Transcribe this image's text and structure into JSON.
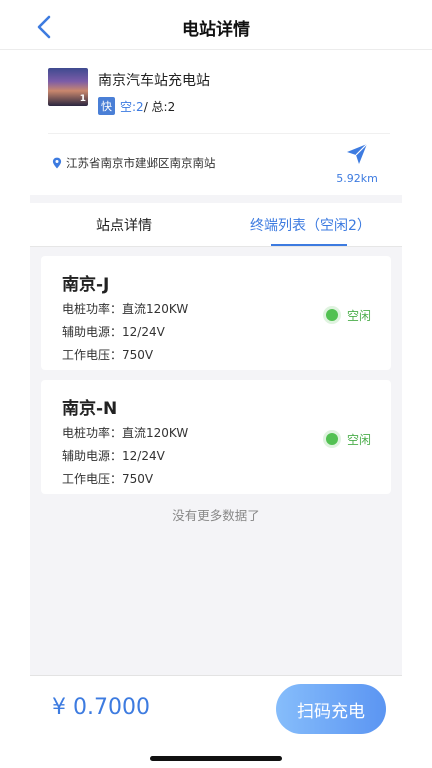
{
  "header": {
    "title": "电站详情",
    "back_icon": "chevron-left-icon"
  },
  "station": {
    "name": "南京汽车站充电站",
    "thumbnail_badge": "1",
    "fast_label": "快",
    "free_label": "空:2",
    "total_label": " / 总:2",
    "address": "江苏省南京市建邺区南京南站",
    "distance": "5.92km"
  },
  "tabs": {
    "info_label": "站点详情",
    "terminals_label": "终端列表（空闲2）",
    "active": "terminals"
  },
  "terminals": [
    {
      "name": "南京-J",
      "power": "电桩功率：直流120KW",
      "aux": "辅助电源：12/24V",
      "voltage": "工作电压：750V",
      "status": "空闲"
    },
    {
      "name": "南京-N",
      "power": "电桩功率：直流120KW",
      "aux": "辅助电源：12/24V",
      "voltage": "工作电压：750V",
      "status": "空闲"
    }
  ],
  "list": {
    "no_more": "没有更多数据了"
  },
  "footer": {
    "price": "¥ 0.7000",
    "scan_button": "扫码充电"
  },
  "colors": {
    "accent": "#3d7be0",
    "idle": "#52c152",
    "background": "#f4f4f7"
  }
}
